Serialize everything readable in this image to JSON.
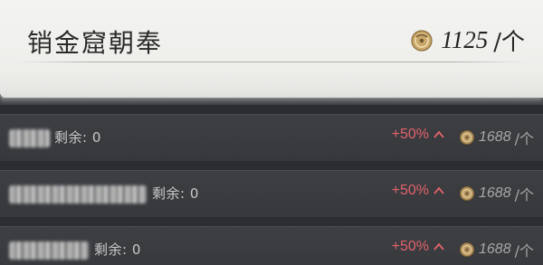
{
  "header": {
    "title": "销金窟朝奉",
    "price": "1125",
    "unit": "/个",
    "coin_icon": "coin-icon"
  },
  "rows": [
    {
      "remaining_label": "剩余: 0",
      "percent": "+50%",
      "price": "1688",
      "unit": "/个"
    },
    {
      "remaining_label": "剩余: 0",
      "percent": "+50%",
      "price": "1688",
      "unit": "/个"
    },
    {
      "remaining_label": "剩余: 0",
      "percent": "+50%",
      "price": "1688",
      "unit": "/个"
    }
  ],
  "colors": {
    "percent_up": "#e2636a",
    "header_bg": "#f0f0ee",
    "row_bg": "#3a3c40"
  }
}
